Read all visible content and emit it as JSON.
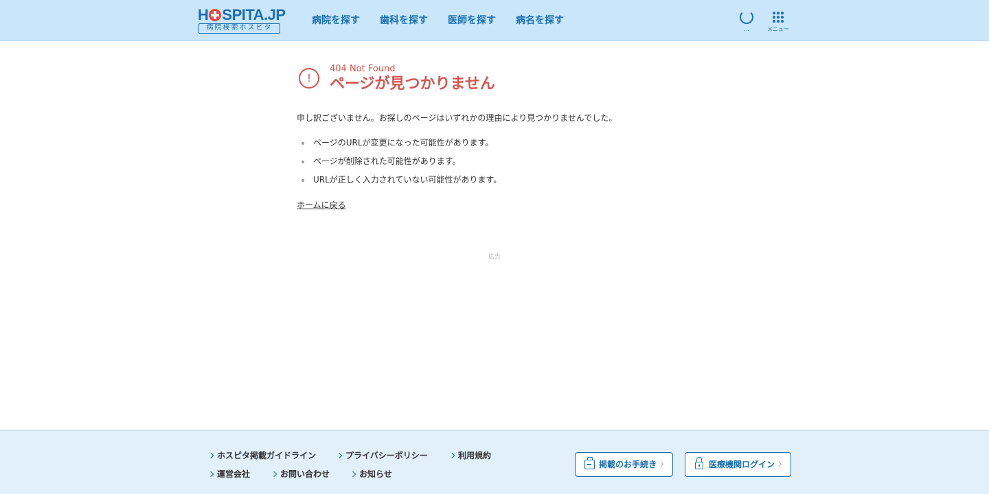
{
  "header": {
    "logo": {
      "main_pre": "H",
      "main_post": "SPITA.JP",
      "sub": "病院検索ホスピタ"
    },
    "nav": [
      {
        "label": "病院を探す"
      },
      {
        "label": "歯科を探す"
      },
      {
        "label": "医師を探す"
      },
      {
        "label": "病名を探す"
      }
    ],
    "loading_label": "...",
    "menu_label": "メニュー"
  },
  "main": {
    "error_icon": "!",
    "error_code": "404 Not Found",
    "error_title": "ページが見つかりません",
    "description": "申し訳ございません。お探しのページはいずれかの理由により見つかりませんでした。",
    "reasons": [
      "ページのURLが変更になった可能性があります。",
      "ページが削除された可能性があります。",
      "URLが正しく入力されていない可能性があります。"
    ],
    "home_link": "ホームに戻る",
    "ad_label": "広告"
  },
  "footer": {
    "links": [
      {
        "label": "ホスピタ掲載ガイドライン"
      },
      {
        "label": "プライバシーポリシー"
      },
      {
        "label": "利用規約"
      },
      {
        "label": "運営会社"
      },
      {
        "label": "お問い合わせ"
      },
      {
        "label": "お知らせ"
      }
    ],
    "listing_button": "掲載のお手続き",
    "login_button": "医療機関ログイン"
  },
  "colors": {
    "header_bg": "#c9e6fb",
    "brand_blue": "#1a6fb0",
    "error_red": "#d9534f",
    "footer_bg": "#e2f0fb"
  },
  "icons": [
    "loading-spinner-icon",
    "grid-menu-icon",
    "exclamation-circle-icon",
    "chevron-right-icon",
    "document-icon",
    "lock-icon"
  ]
}
